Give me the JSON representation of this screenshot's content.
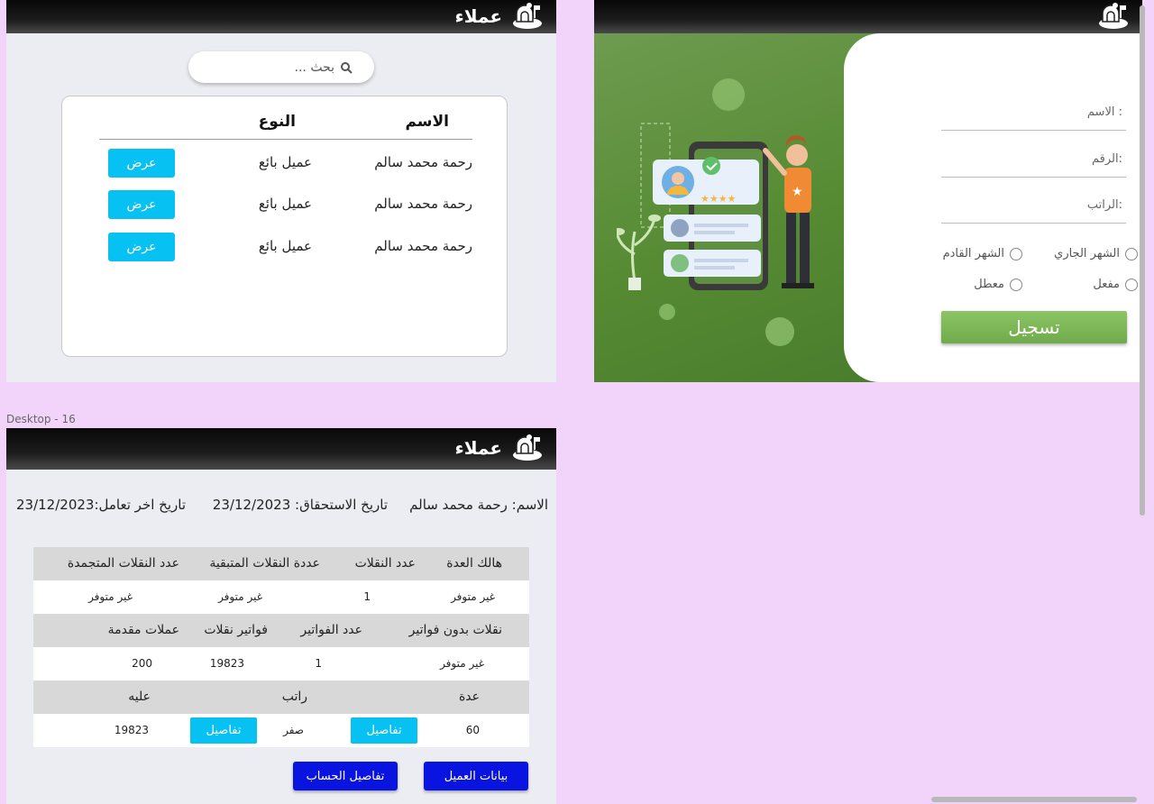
{
  "app": {
    "brand_title": "عملاء",
    "brand_logo_icon": "mailbox-icon"
  },
  "customers_list": {
    "search_placeholder": "بحث ...",
    "headers": {
      "name": "الاسم",
      "type": "النوع"
    },
    "rows": [
      {
        "name": "رحمة محمد سالم",
        "type": "عميل بائع",
        "action": "عرض"
      },
      {
        "name": "رحمة محمد سالم",
        "type": "عميل بائع",
        "action": "عرض"
      },
      {
        "name": "رحمة محمد سالم",
        "type": "عميل بائع",
        "action": "عرض"
      }
    ]
  },
  "register_form": {
    "fields": {
      "name": "الاسم :",
      "number": "الرقم:",
      "salary": "الراتب:"
    },
    "period": {
      "current": "الشهر الجاري",
      "next": "الشهر القادم"
    },
    "status": {
      "active": "مفعل",
      "disabled": "معطل"
    },
    "submit": "تسجيل",
    "illustration_icon": "phone-reviews-illustration"
  },
  "frame_label": "Desktop - 16",
  "customer_details": {
    "name": "الاسم: رحمة محمد سالم",
    "due_date": "تاريخ الاستحقاق:  23/12/2023",
    "last_transaction": "تاريخ اخر تعامل:23/12/2023",
    "rows": {
      "h1": [
        "هالك العدة",
        "عدد النقلات",
        "عددة النقلات المتبقية",
        "عدد النقلات المتجمدة"
      ],
      "v1": [
        "غير متوفر",
        "1",
        "غير متوفر",
        "غير متوفر"
      ],
      "h2": [
        "نقلات بدون فواتير",
        "عدد الفواتير",
        "فواتير نقلات",
        "عملات مقدمة"
      ],
      "v2": [
        "غير متوفر",
        "1",
        "19823",
        "200"
      ],
      "h3": [
        "عدة",
        "راتب",
        "عليه"
      ],
      "v3": [
        "60",
        "صفر",
        "19823"
      ],
      "details_label": "تفاصيل"
    },
    "buttons": {
      "customer_data": "بيانات العميل",
      "account_details": "تفاصيل الحساب"
    }
  },
  "colors": {
    "accent": "#08c1f3",
    "green": "#6fab4a",
    "blue": "#0a14e0",
    "background": "#f2d4fb"
  }
}
